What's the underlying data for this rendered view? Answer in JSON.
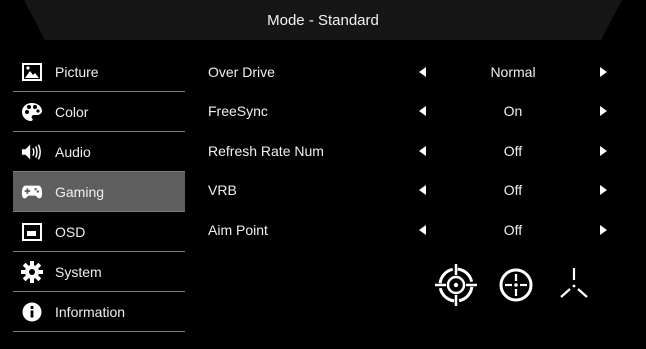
{
  "header": {
    "title": "Mode - Standard"
  },
  "sidebar": {
    "items": [
      {
        "label": "Picture",
        "icon": "picture-icon"
      },
      {
        "label": "Color",
        "icon": "palette-icon"
      },
      {
        "label": "Audio",
        "icon": "speaker-icon"
      },
      {
        "label": "Gaming",
        "icon": "gamepad-icon",
        "active": true
      },
      {
        "label": "OSD",
        "icon": "osd-window-icon"
      },
      {
        "label": "System",
        "icon": "gear-icon"
      },
      {
        "label": "Information",
        "icon": "info-icon"
      }
    ]
  },
  "settings": {
    "rows": [
      {
        "label": "Over Drive",
        "value": "Normal"
      },
      {
        "label": "FreeSync",
        "value": "On"
      },
      {
        "label": "Refresh Rate Num",
        "value": "Off"
      },
      {
        "label": "VRB",
        "value": "Off"
      },
      {
        "label": "Aim Point",
        "value": "Off"
      }
    ]
  },
  "aim_point_options": [
    "crosshair-circle-icon",
    "crosshair-dot-icon",
    "crosshair-tri-icon"
  ],
  "colors": {
    "background": "#000000",
    "active_item": "#5e5e5e",
    "titlebar": "#161616",
    "divider": "#7a7a7a"
  }
}
